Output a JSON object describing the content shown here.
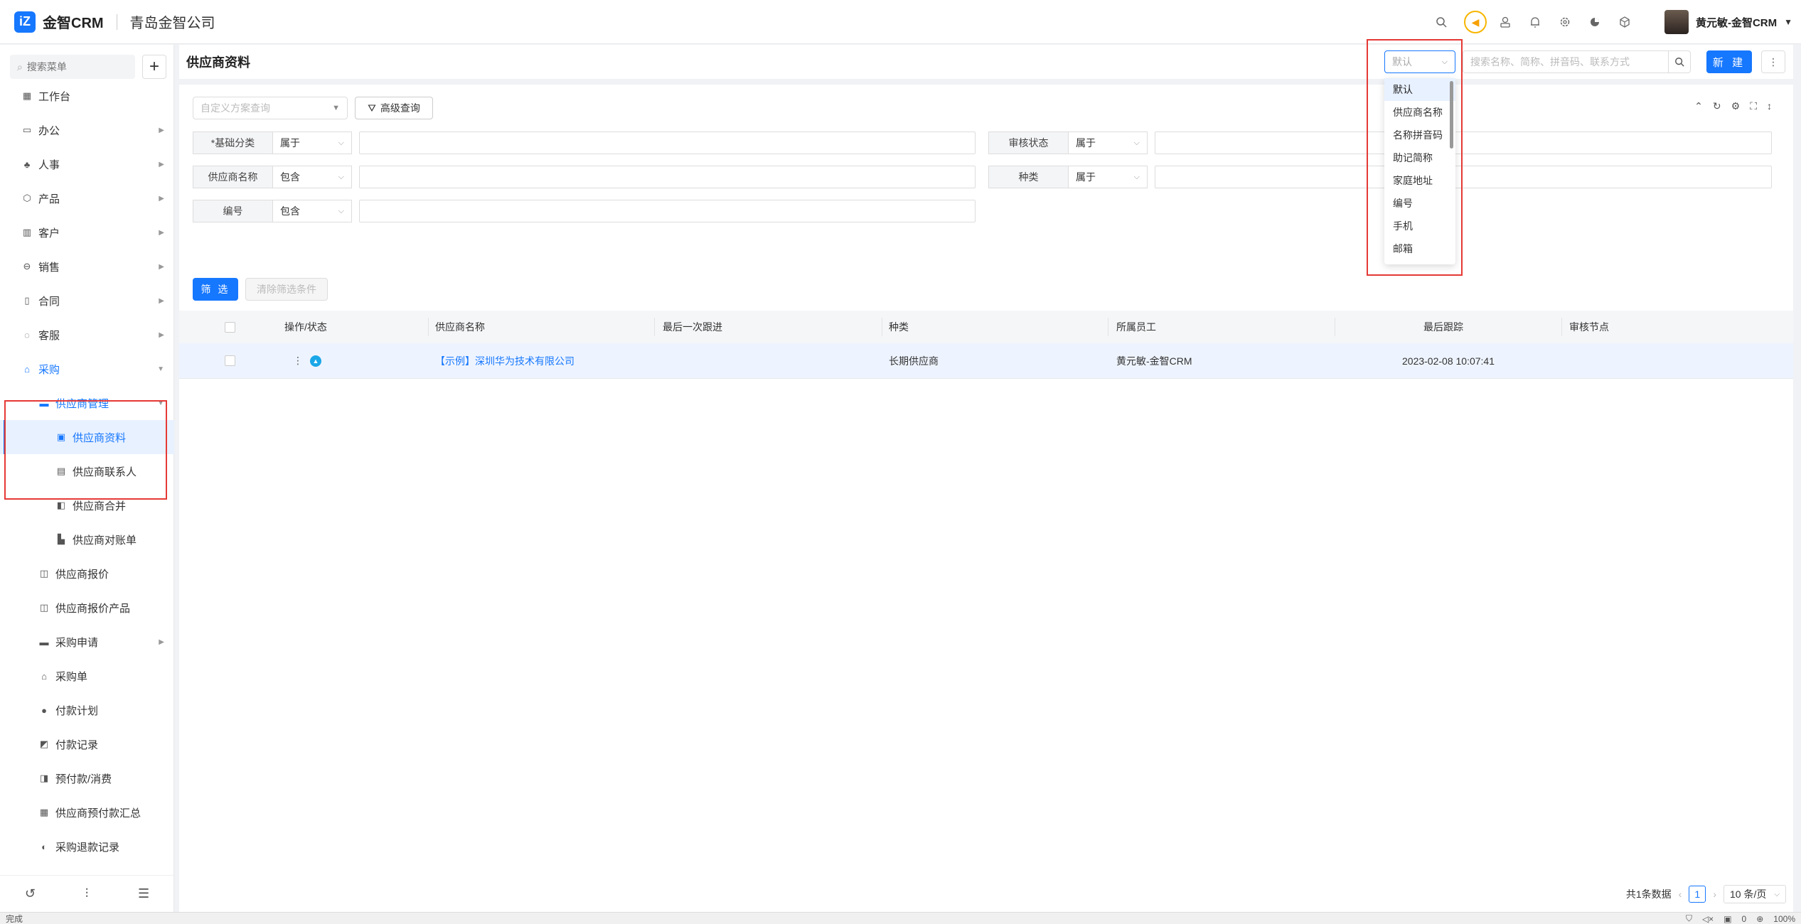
{
  "header": {
    "logo_mark": "iZ",
    "app_name": "金智CRM",
    "company": "青岛金智公司",
    "user_name": "黄元敏-金智CRM",
    "icons": [
      "search-icon",
      "promo-icon",
      "contacts-icon",
      "bell-icon",
      "gear-icon",
      "pie-chart-icon",
      "cube-icon"
    ]
  },
  "sidebar": {
    "search_placeholder": "搜索菜单",
    "add_label": "+",
    "items": [
      {
        "label": "工作台",
        "icon": "dashboard-icon"
      },
      {
        "label": "办公",
        "icon": "monitor-icon"
      },
      {
        "label": "人事",
        "icon": "people-icon"
      },
      {
        "label": "产品",
        "icon": "box-icon"
      },
      {
        "label": "客户",
        "icon": "chart-icon"
      },
      {
        "label": "销售",
        "icon": "circle-icon"
      },
      {
        "label": "合同",
        "icon": "doc-icon"
      },
      {
        "label": "客服",
        "icon": "headset-icon"
      },
      {
        "label": "采购",
        "icon": "store-icon"
      },
      {
        "label": "供应商管理",
        "icon": "folder-icon"
      },
      {
        "label": "供应商资料",
        "icon": "card-icon"
      },
      {
        "label": "供应商联系人",
        "icon": "contact-book-icon"
      },
      {
        "label": "供应商合并",
        "icon": "merge-icon"
      },
      {
        "label": "供应商对账单",
        "icon": "printer-icon"
      },
      {
        "label": "供应商报价",
        "icon": "quote-icon"
      },
      {
        "label": "供应商报价产品",
        "icon": "quote-product-icon"
      },
      {
        "label": "采购申请",
        "icon": "folder-icon"
      },
      {
        "label": "采购单",
        "icon": "store-icon"
      },
      {
        "label": "付款计划",
        "icon": "plan-icon"
      },
      {
        "label": "付款记录",
        "icon": "record-icon"
      },
      {
        "label": "预付款/消费",
        "icon": "wallet-icon"
      },
      {
        "label": "供应商预付款汇总",
        "icon": "summary-icon"
      },
      {
        "label": "采购退款记录",
        "icon": "refund-icon"
      }
    ]
  },
  "page": {
    "title": "供应商资料",
    "search_field_value": "默认",
    "search_placeholder": "搜索名称、简称、拼音码、联系方式",
    "new_label": "新 建"
  },
  "filters": {
    "scheme_placeholder": "自定义方案查询",
    "advanced_label": "高级查询",
    "rows": [
      {
        "label": "*基础分类",
        "op": "属于"
      },
      {
        "label": "审核状态",
        "op": "属于"
      },
      {
        "label": "供应商名称",
        "op": "包含"
      },
      {
        "label": "种类",
        "op": "属于"
      },
      {
        "label": "编号",
        "op": "包含"
      }
    ],
    "filter_label": "筛 选",
    "clear_label": "清除筛选条件"
  },
  "table": {
    "headers": [
      "操作/状态",
      "供应商名称",
      "最后一次跟进",
      "种类",
      "所属员工",
      "最后跟踪",
      "审核节点"
    ],
    "rows": [
      {
        "name": "【示例】深圳华为技术有限公司",
        "last_followup": "",
        "kind": "长期供应商",
        "employee": "黄元敏-金智CRM",
        "last_track": "2023-02-08 10:07:41",
        "audit_node": ""
      }
    ]
  },
  "pager": {
    "total": "共1条数据",
    "current": "1",
    "page_size": "10 条/页"
  },
  "dropdown": {
    "options": [
      "默认",
      "供应商名称",
      "名称拼音码",
      "助记简称",
      "家庭地址",
      "编号",
      "手机",
      "邮箱"
    ]
  },
  "statusbar": {
    "left": "完成",
    "mute_count": "0",
    "zoom": "100%"
  }
}
